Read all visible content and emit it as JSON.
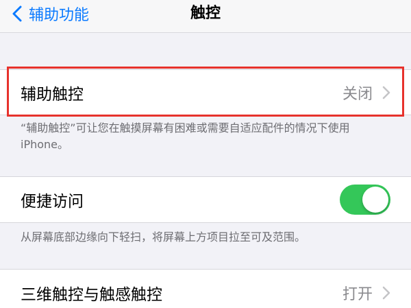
{
  "nav": {
    "back_label": "辅助功能",
    "title": "触控"
  },
  "assistive_touch": {
    "label": "辅助触控",
    "value": "关闭",
    "footer": "“辅助触控”可让您在触摸屏幕有困难或需要自适应配件的情况下使用 iPhone。"
  },
  "reachability": {
    "label": "便捷访问",
    "enabled": true,
    "footer": "从屏幕底部边缘向下轻扫，将屏幕上方项目拉至可及范围。"
  },
  "touch_3d": {
    "label": "三维触控与触感触控",
    "value": "打开"
  },
  "colors": {
    "accent": "#0a7aff",
    "toggle_on": "#34c759",
    "highlight": "#e7322c"
  },
  "icons": [
    "chevron-left-icon",
    "chevron-right-icon"
  ]
}
